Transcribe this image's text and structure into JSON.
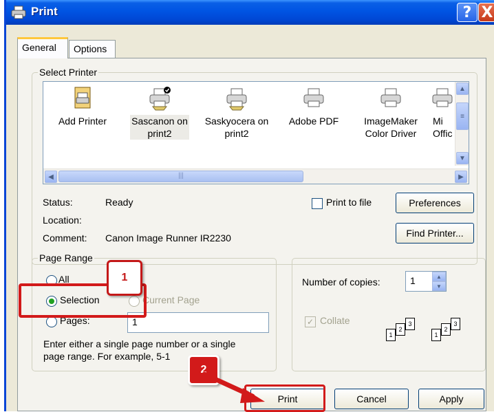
{
  "window": {
    "title": "Print",
    "help_button": "?",
    "close_button": "X"
  },
  "tabs": [
    {
      "label": "General",
      "active": true
    },
    {
      "label": "Options",
      "active": false
    }
  ],
  "select_printer": {
    "legend": "Select Printer",
    "printers": [
      {
        "line1": "Add Printer",
        "line2": "",
        "icon": "add-printer-icon"
      },
      {
        "line1": "Sascanon on",
        "line2": "print2",
        "icon": "default-printer-icon",
        "selected": true
      },
      {
        "line1": "Saskyocera on",
        "line2": "print2",
        "icon": "printer-icon"
      },
      {
        "line1": "Adobe PDF",
        "line2": "",
        "icon": "printer-icon"
      },
      {
        "line1": "ImageMaker",
        "line2": "Color Driver",
        "icon": "printer-icon"
      },
      {
        "line1": "Mi",
        "line2": "Offic",
        "icon": "printer-icon"
      }
    ],
    "status_label": "Status:",
    "status_value": "Ready",
    "location_label": "Location:",
    "location_value": "",
    "comment_label": "Comment:",
    "comment_value": "Canon Image Runner IR2230",
    "print_to_file_label": "Print to file",
    "print_to_file_checked": false,
    "preferences_button": "Preferences",
    "find_printer_button": "Find Printer..."
  },
  "page_range": {
    "legend": "Page Range",
    "all_label": "All",
    "selection_label": "Selection",
    "current_page_label": "Current Page",
    "pages_label": "Pages:",
    "pages_value": "1",
    "selected_option": "Selection",
    "help_text_line1": "Enter either a single page number or a single",
    "help_text_line2": "page range.  For example, 5-1"
  },
  "copies": {
    "number_label": "Number of copies:",
    "number_value": "1",
    "collate_label": "Collate",
    "collate_checked": true
  },
  "buttons": {
    "print": "Print",
    "cancel": "Cancel",
    "apply": "Apply"
  },
  "annotations": {
    "callout_1": "1",
    "callout_2": "2",
    "accent_color": "#d21a1a"
  }
}
